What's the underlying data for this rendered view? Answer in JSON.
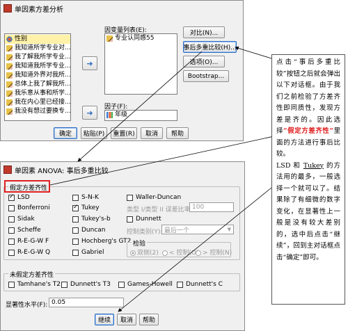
{
  "top_dialog": {
    "title": "单因素方差分析",
    "source_list": [
      {
        "icon": "scale-icon",
        "text": "性别"
      },
      {
        "icon": "pencil-icon",
        "text": "我知道所学专业对..."
      },
      {
        "icon": "pencil-icon",
        "text": "我了解我所学专业..."
      },
      {
        "icon": "pencil-icon",
        "text": "我知道我所学专业..."
      },
      {
        "icon": "pencil-icon",
        "text": "我知道外界对我所..."
      },
      {
        "icon": "pencil-icon",
        "text": "总体上我了解我所..."
      },
      {
        "icon": "pencil-icon",
        "text": "我乐意从事和所学..."
      },
      {
        "icon": "pencil-icon",
        "text": "我在内心里已经接..."
      },
      {
        "icon": "pencil-icon",
        "text": "我没有想过要换专..."
      }
    ],
    "dependent_label": "因变量列表(E):",
    "dependent_items": [
      {
        "icon": "pencil-icon",
        "text": "专业认同感55"
      }
    ],
    "factor_label": "因子(F):",
    "factor_value": {
      "icon": "bars-icon",
      "text": "年级"
    },
    "side_buttons": [
      "对比(N)...",
      "事后多重比较(H)...",
      "选项(O)...",
      "Bootstrap..."
    ],
    "bottom_buttons": [
      "确定",
      "粘贴(P)",
      "重置(R)",
      "取消",
      "帮助"
    ]
  },
  "bottom_dialog": {
    "title": "单因素 ANOVA: 事后多重比较",
    "equal_group_title": "假定方差齐性",
    "equal_checks": [
      {
        "label": "LSD",
        "checked": true,
        "disabled": false
      },
      {
        "label": "S-N-K",
        "checked": false,
        "disabled": false
      },
      {
        "label": "Waller-Duncan",
        "checked": false,
        "disabled": false
      },
      {
        "label": "Bonferroni",
        "checked": false,
        "disabled": false
      },
      {
        "label": "Tukey",
        "checked": true,
        "disabled": false
      },
      {
        "label": "Sidak",
        "checked": false,
        "disabled": false
      },
      {
        "label": "Tukey's-b",
        "checked": false,
        "disabled": false
      },
      {
        "label": "Dunnett",
        "checked": false,
        "disabled": false
      },
      {
        "label": "Scheffe",
        "checked": false,
        "disabled": false
      },
      {
        "label": "Duncan",
        "checked": false,
        "disabled": false
      },
      {
        "label": "R-E-G-W F",
        "checked": false,
        "disabled": false
      },
      {
        "label": "Hochberg's GT2",
        "checked": false,
        "disabled": false
      },
      {
        "label": "R-E-G-W Q",
        "checked": false,
        "disabled": false
      },
      {
        "label": "Gabriel",
        "checked": false,
        "disabled": false
      }
    ],
    "error_ratio_label": "类型 I/类型 II 误差比率:",
    "error_ratio_value": "100",
    "control_label": "控制类别(Y):",
    "control_value": "最后一个",
    "test_group_title": "检验",
    "test_options": [
      "双侧(2)",
      "< 控制(O)",
      "> 控制(N)"
    ],
    "unequal_group_title": "未假定方差齐性",
    "unequal_checks": [
      "Tamhane's T2",
      "Dunnett's T3",
      "Games-Howell",
      "Dunnett's C"
    ],
    "sig_label": "显著性水平(F):",
    "sig_value": "0.05",
    "buttons": [
      "继续",
      "取消",
      "帮助"
    ]
  },
  "annotation": {
    "part1": "点击“事后多重比较”按钮之后就会弹出以下对话框。由于我们之前检验了方差齐性即同质性，发现方差是齐的。因此选择",
    "highlight": "“假定方差齐性”",
    "part2": "里面的方法进行事后比较。",
    "para2_a": "LSD 和 ",
    "para2_tukey": "Tukey",
    "para2_b": " 的方法用的最多，一般选择一个就可以了。结果除了有细微的数字变化，在显著性上一般是没有较大差别的，选中后点击“继续”，回到主对话框点击“确定”即可。"
  },
  "colors": {
    "accent_blue": "#2f6cc0",
    "highlight_red": "#e02020",
    "selected_row": "#fff2a8",
    "dialog_bg": "#f0f0f0"
  }
}
